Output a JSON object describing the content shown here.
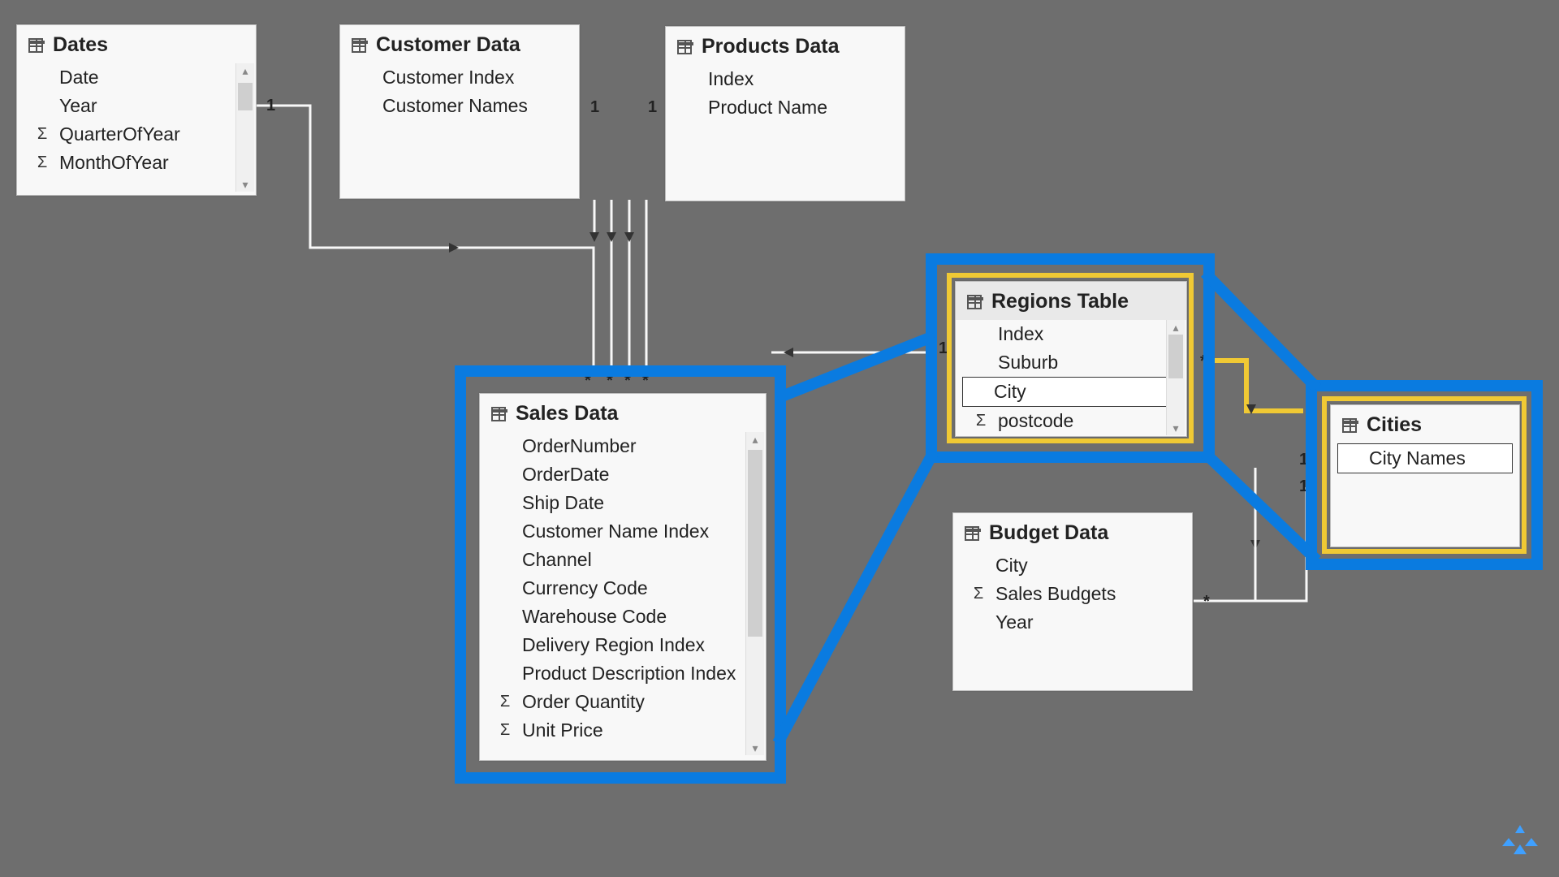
{
  "tables": {
    "dates": {
      "title": "Dates",
      "fields": [
        {
          "name": "Date",
          "agg": false
        },
        {
          "name": "Year",
          "agg": false
        },
        {
          "name": "QuarterOfYear",
          "agg": true
        },
        {
          "name": "MonthOfYear",
          "agg": true
        }
      ]
    },
    "customer": {
      "title": "Customer Data",
      "fields": [
        {
          "name": "Customer Index",
          "agg": false
        },
        {
          "name": "Customer Names",
          "agg": false
        }
      ]
    },
    "products": {
      "title": "Products Data",
      "fields": [
        {
          "name": "Index",
          "agg": false
        },
        {
          "name": "Product Name",
          "agg": false
        }
      ]
    },
    "sales": {
      "title": "Sales Data",
      "fields": [
        {
          "name": "OrderNumber",
          "agg": false
        },
        {
          "name": "OrderDate",
          "agg": false
        },
        {
          "name": "Ship Date",
          "agg": false
        },
        {
          "name": "Customer Name Index",
          "agg": false
        },
        {
          "name": "Channel",
          "agg": false
        },
        {
          "name": "Currency Code",
          "agg": false
        },
        {
          "name": "Warehouse Code",
          "agg": false
        },
        {
          "name": "Delivery Region Index",
          "agg": false
        },
        {
          "name": "Product Description Index",
          "agg": false
        },
        {
          "name": "Order Quantity",
          "agg": true
        },
        {
          "name": "Unit Price",
          "agg": true
        }
      ]
    },
    "regions": {
      "title": "Regions Table",
      "fields": [
        {
          "name": "Index",
          "agg": false
        },
        {
          "name": "Suburb",
          "agg": false
        },
        {
          "name": "City",
          "agg": false,
          "boxed": true
        },
        {
          "name": "postcode",
          "agg": true
        }
      ]
    },
    "budget": {
      "title": "Budget Data",
      "fields": [
        {
          "name": "City",
          "agg": false
        },
        {
          "name": "Sales Budgets",
          "agg": true
        },
        {
          "name": "Year",
          "agg": false
        }
      ]
    },
    "cities": {
      "title": "Cities",
      "fields": [
        {
          "name": "City Names",
          "agg": false,
          "boxed": true
        }
      ]
    }
  },
  "cardinality": {
    "one": "1",
    "many": "*"
  },
  "relationships": [
    {
      "from": "dates",
      "to": "sales",
      "from_card": "1",
      "to_card": "*"
    },
    {
      "from": "customer",
      "to": "sales",
      "from_card": "1",
      "to_card": "*"
    },
    {
      "from": "products",
      "to": "sales",
      "from_card": "1",
      "to_card": "*"
    },
    {
      "from": "regions",
      "to": "sales",
      "from_card": "1",
      "to_card": "*"
    },
    {
      "from": "regions",
      "to": "cities",
      "from_card": "*",
      "to_card": "1",
      "highlighted": true
    },
    {
      "from": "cities",
      "to": "budget",
      "from_card": "1",
      "to_card": "*"
    }
  ]
}
